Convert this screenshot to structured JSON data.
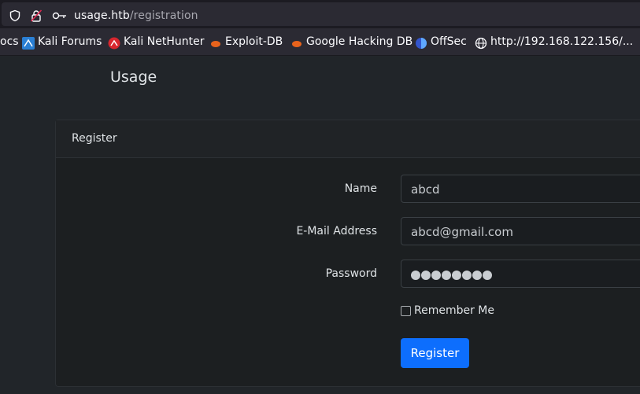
{
  "browser": {
    "url_host": "usage.htb",
    "url_path": "/registration",
    "bookmarks": [
      {
        "label": "ocs"
      },
      {
        "label": "Kali Forums"
      },
      {
        "label": "Kali NetHunter"
      },
      {
        "label": "Exploit-DB"
      },
      {
        "label": "Google Hacking DB"
      },
      {
        "label": "OffSec"
      },
      {
        "label": "http://192.168.122.156/..."
      }
    ]
  },
  "navbar": {
    "brand": "Usage"
  },
  "form": {
    "title": "Register",
    "name_label": "Name",
    "name_value": "abcd",
    "email_label": "E-Mail Address",
    "email_value": "abcd@gmail.com",
    "password_label": "Password",
    "password_mask_count": 8,
    "remember_label": "Remember Me",
    "remember_checked": false,
    "submit_label": "Register"
  },
  "colors": {
    "accent": "#0d6efd",
    "page_bg": "#212529"
  }
}
